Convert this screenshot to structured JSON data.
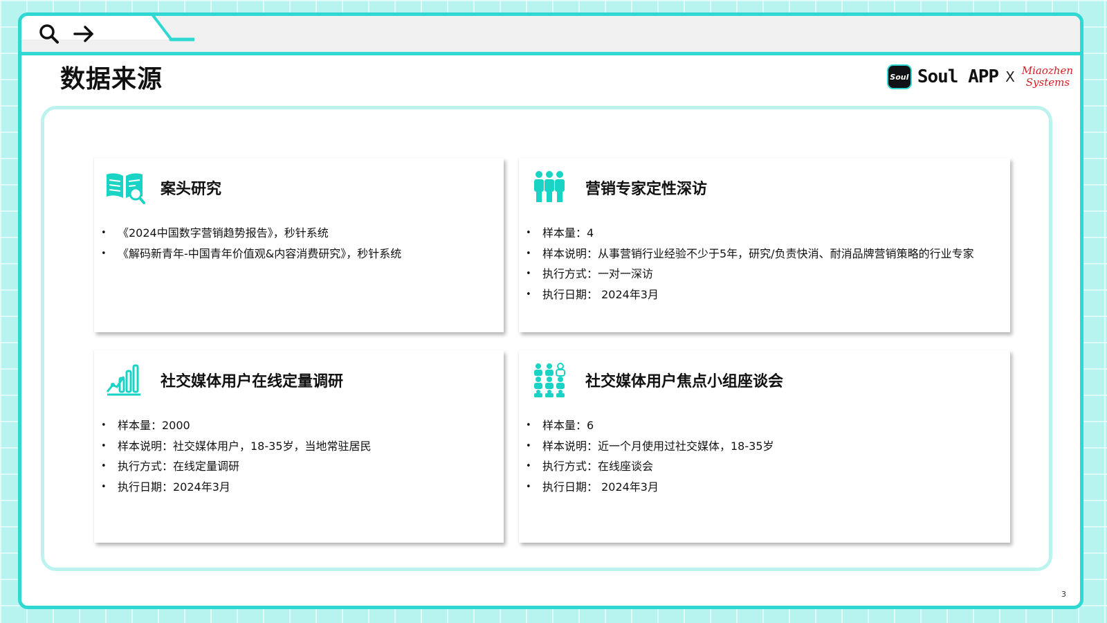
{
  "page_title": "数据来源",
  "logos": {
    "soul_badge": "Soul",
    "soul_app": "Soul APP",
    "separator": "X",
    "miaozhen_line1": "Miaozhen",
    "miaozhen_line2": "Systems"
  },
  "cards": [
    {
      "title": "案头研究",
      "icon": "book-search-icon",
      "items": [
        "《2024中国数字营销趋势报告》，秒针系统",
        "《解码新青年-中国青年价值观&内容消费研究》，秒针系统"
      ]
    },
    {
      "title": "营销专家定性深访",
      "icon": "people-group-icon",
      "items": [
        "样本量：4",
        "样本说明：从事营销行业经验不少于5年，研究/负责快消、耐消品牌营销策略的行业专家",
        "执行方式：一对一深访",
        "执行日期： 2024年3月"
      ]
    },
    {
      "title": "社交媒体用户在线定量调研",
      "icon": "bar-chart-icon",
      "items": [
        "样本量：2000",
        "样本说明：社交媒体用户，18-35岁，当地常驻居民",
        "执行方式：在线定量调研",
        "执行日期：2024年3月"
      ]
    },
    {
      "title": "社交媒体用户焦点小组座谈会",
      "icon": "focus-group-icon",
      "items": [
        "样本量：6",
        "样本说明：近一个月使用过社交媒体，18-35岁",
        "执行方式：在线座谈会",
        "执行日期： 2024年3月"
      ]
    }
  ],
  "page_number": "3",
  "colors": {
    "accent": "#2fd9d2",
    "icon": "#19d3c5",
    "miaozhen_red": "#d41c22"
  }
}
